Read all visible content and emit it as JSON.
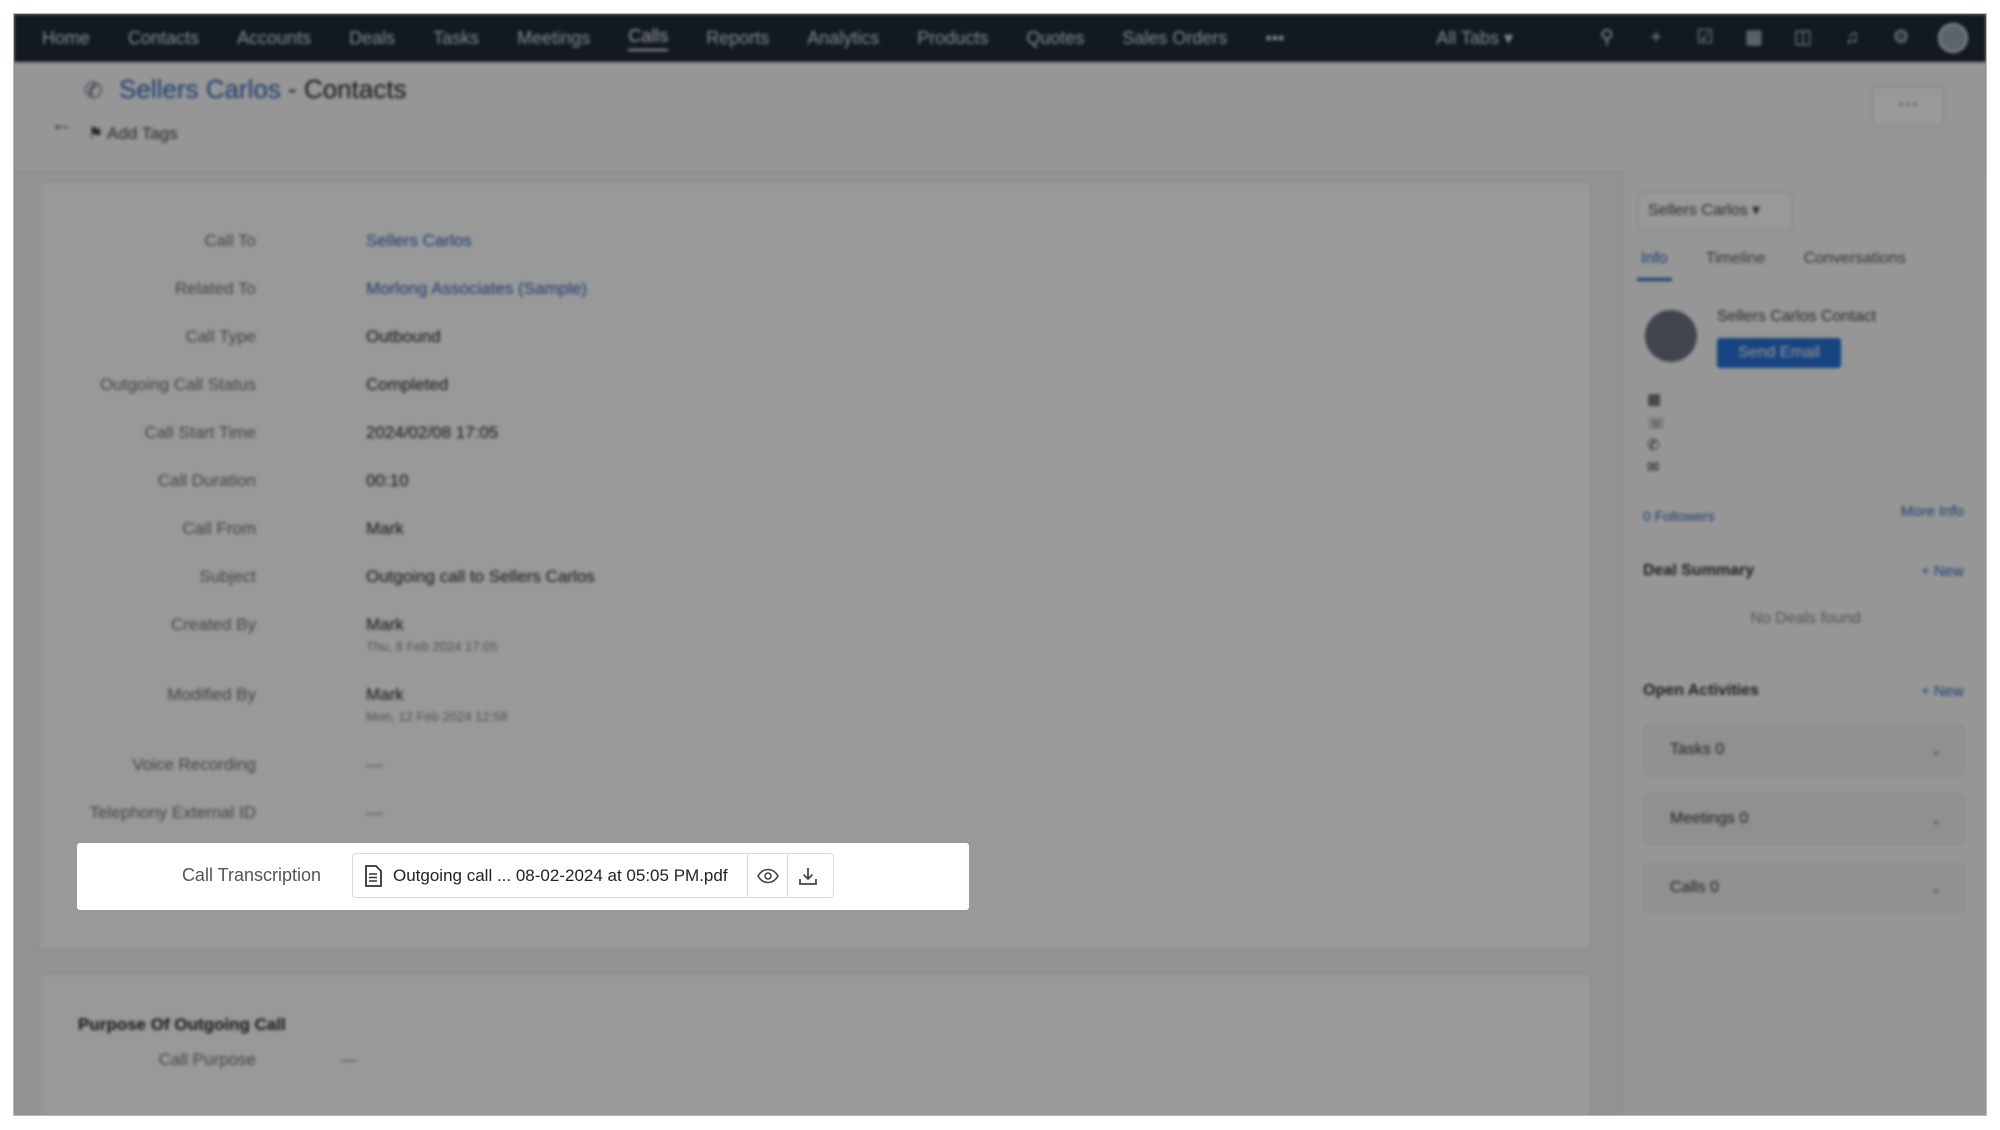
{
  "nav": {
    "items": [
      "Home",
      "Contacts",
      "Accounts",
      "Deals",
      "Tasks",
      "Meetings",
      "Calls",
      "Reports",
      "Analytics",
      "Products",
      "Quotes",
      "Sales Orders",
      "•••"
    ],
    "active": "Calls",
    "all_tabs": "All Tabs ▾",
    "icons": [
      "search-icon",
      "plus-icon",
      "calendar-check-icon",
      "calendar-icon",
      "store-icon",
      "bell-icon",
      "gear-icon",
      "avatar"
    ]
  },
  "header": {
    "record_name": "Sellers Carlos",
    "separator": " - ",
    "module": "Contacts",
    "add_tags": "Add Tags",
    "back": "←",
    "more": "···"
  },
  "details": [
    {
      "label": "Call To",
      "value": "Sellers Carlos",
      "link": true
    },
    {
      "label": "Related To",
      "value": "Morlong Associates (Sample)",
      "link": true
    },
    {
      "label": "Call Type",
      "value": "Outbound"
    },
    {
      "label": "Outgoing Call Status",
      "value": "Completed"
    },
    {
      "label": "Call Start Time",
      "value": "2024/02/08 17:05"
    },
    {
      "label": "Call Duration",
      "value": "00:10"
    },
    {
      "label": "Call From",
      "value": "Mark"
    },
    {
      "label": "Subject",
      "value": "Outgoing call to Sellers Carlos"
    },
    {
      "label": "Created By",
      "value": "Mark",
      "sub": "Thu, 8 Feb 2024 17:05"
    },
    {
      "label": "Modified By",
      "value": "Mark",
      "sub": "Mon, 12 Feb 2024 12:58"
    },
    {
      "label": "Voice Recording",
      "value": "—"
    },
    {
      "label": "Telephony External ID",
      "value": "—"
    }
  ],
  "transcription": {
    "label": "Call Transcription",
    "file_name": "Outgoing call ...  08-02-2024 at 05:05 PM.pdf"
  },
  "purpose": {
    "title": "Purpose Of Outgoing Call",
    "call_purpose_label": "Call Purpose",
    "call_purpose_value": "—"
  },
  "side": {
    "dropdown": "Sellers Carlos ▾",
    "tabs": [
      "Info",
      "Timeline",
      "Conversations"
    ],
    "contact_name": "Sellers Carlos Contact",
    "send_email": "Send Email",
    "followers": "0 Followers",
    "more_info": "More Info",
    "deal_summary": "Deal Summary",
    "new": "+ New",
    "no_deals": "No Deals found",
    "open_activities": "Open Activities",
    "tasks": "Tasks   0",
    "meetings": "Meetings   0",
    "calls": "Calls   0"
  }
}
